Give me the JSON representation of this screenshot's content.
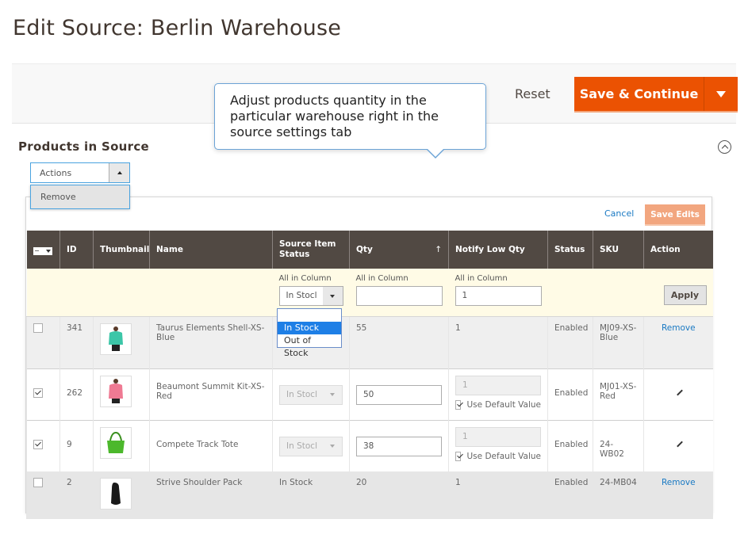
{
  "page": {
    "title": "Edit Source: Berlin Warehouse"
  },
  "toolbar": {
    "reset_label": "Reset",
    "save_label": "Save & Continue",
    "colors": {
      "primary": "#eb5202"
    }
  },
  "tooltip": {
    "text": "Adjust products quantity in the particular warehouse right in the source settings tab"
  },
  "section": {
    "title": "Products in Source"
  },
  "actions": {
    "label": "Actions",
    "options": [
      "Remove"
    ]
  },
  "grid_toolbar": {
    "cancel_label": "Cancel",
    "save_edits_label": "Save Edits"
  },
  "grid": {
    "columns": [
      "ID",
      "Thumbnail",
      "Name",
      "Source Item Status",
      "Qty",
      "Notify Low Qty",
      "Status",
      "SKU",
      "Action"
    ],
    "qty_sort_indicator": "↑",
    "filter": {
      "all_in_column_label": "All in Column",
      "status_value": "In Stocl",
      "status_options": [
        "",
        "In Stock",
        "Out of Stock"
      ],
      "status_selected": "In Stock",
      "qty_value": "",
      "notify_value": "1",
      "apply_label": "Apply"
    },
    "rows": [
      {
        "checked": false,
        "id": "341",
        "name": "Taurus Elements Shell-XS-Blue",
        "source_status": "",
        "qty": "55",
        "notify": "1",
        "status": "Enabled",
        "sku": "MJ09-XS-Blue",
        "action": "Remove",
        "thumb_color": "#3cc6a8"
      },
      {
        "checked": true,
        "id": "262",
        "name": "Beaumont Summit Kit-XS-Red",
        "source_status": "In Stocl",
        "qty": "50",
        "notify": "1",
        "use_default": "Use Default Value",
        "status": "Enabled",
        "sku": "MJ01-XS-Red",
        "action": "edit",
        "thumb_color": "#ef7a93"
      },
      {
        "checked": true,
        "id": "9",
        "name": "Compete Track Tote",
        "source_status": "In Stocl",
        "qty": "38",
        "notify": "1",
        "use_default": "Use Default Value",
        "status": "Enabled",
        "sku": "24-WB02",
        "action": "edit",
        "thumb_color": "#4cb82c"
      },
      {
        "checked": false,
        "id": "2",
        "name": "Strive Shoulder Pack",
        "source_status": "In Stock",
        "qty": "20",
        "notify": "1",
        "status": "Enabled",
        "sku": "24-MB04",
        "action": "Remove",
        "thumb_color": "#1a1a1a"
      }
    ]
  }
}
